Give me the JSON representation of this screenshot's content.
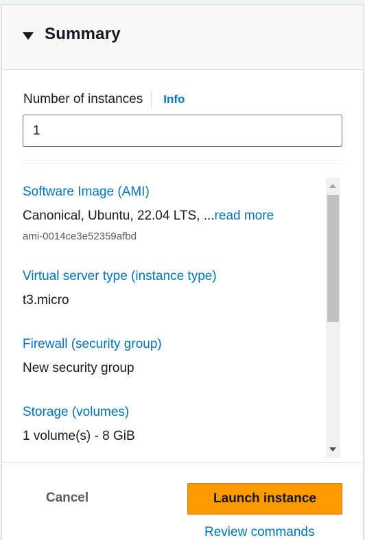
{
  "summary": {
    "title": "Summary",
    "caret_icon": "caret-down-icon"
  },
  "instances": {
    "label": "Number of instances",
    "info_link": "Info",
    "value": "1"
  },
  "details": {
    "ami": {
      "title": "Software Image (AMI)",
      "value": "Canonical, Ubuntu, 22.04 LTS, ...",
      "read_more": "read more",
      "id": "ami-0014ce3e52359afbd"
    },
    "instance_type": {
      "title": "Virtual server type (instance type)",
      "value": "t3.micro"
    },
    "firewall": {
      "title": "Firewall (security group)",
      "value": "New security group"
    },
    "storage": {
      "title": "Storage (volumes)",
      "value": "1 volume(s) - 8 GiB"
    }
  },
  "footer": {
    "cancel_label": "Cancel",
    "launch_label": "Launch instance",
    "review_label": "Review commands"
  },
  "colors": {
    "link": "#0073bb",
    "primary_button": "#ff9900",
    "text": "#16191f"
  }
}
